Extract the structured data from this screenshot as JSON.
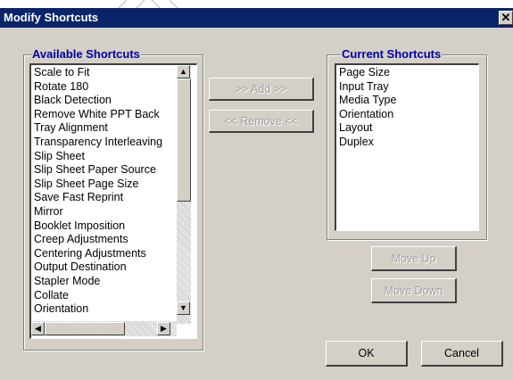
{
  "window": {
    "title": "Modify Shortcuts",
    "close_glyph": "✕"
  },
  "available": {
    "label": "Available Shortcuts",
    "items": [
      "Scale to Fit",
      "Rotate 180",
      "Black Detection",
      "Remove White PPT Back",
      "Tray Alignment",
      "Transparency Interleaving",
      "Slip Sheet",
      "Slip Sheet Paper Source",
      "Slip Sheet Page Size",
      "Save Fast Reprint",
      "Mirror",
      "Booklet Imposition",
      "Creep Adjustments",
      "Centering Adjustments",
      "Output Destination",
      "Stapler Mode",
      "Collate",
      "Orientation"
    ]
  },
  "current": {
    "label": "Current Shortcuts",
    "items": [
      "Page Size",
      "Input Tray",
      "Media Type",
      "Orientation",
      "Layout",
      "Duplex"
    ]
  },
  "buttons": {
    "add": ">> Add >>",
    "remove": "<< Remove <<",
    "move_up": "Move Up",
    "move_down": "Move Down",
    "ok": "OK",
    "cancel": "Cancel"
  },
  "icons": {
    "scroll_up": "up-arrow-icon",
    "scroll_down": "down-arrow-icon",
    "scroll_left": "left-arrow-icon",
    "scroll_right": "right-arrow-icon",
    "close": "close-icon"
  },
  "colors": {
    "titlebar": "#0a246a",
    "dialog": "#d4d0c8",
    "group_label": "#0000a8"
  }
}
